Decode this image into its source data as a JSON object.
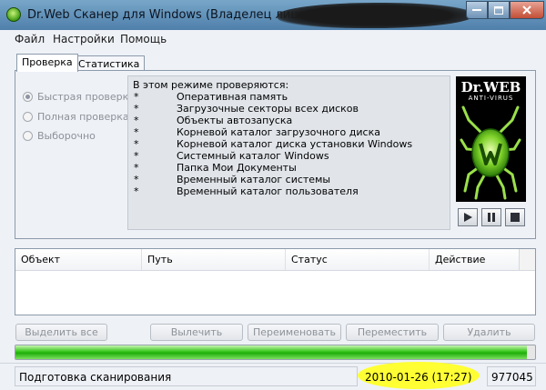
{
  "window": {
    "title": "Dr.Web Сканер для Windows (Владелец лицензии:"
  },
  "menu": [
    "Файл",
    "Настройки",
    "Помощь"
  ],
  "tabs": [
    {
      "label": "Проверка",
      "active": true
    },
    {
      "label": "Статистика",
      "active": false
    }
  ],
  "scan_modes": [
    {
      "label": "Быстрая проверка",
      "selected": true
    },
    {
      "label": "Полная проверка",
      "selected": false
    },
    {
      "label": "Выборочно",
      "selected": false
    }
  ],
  "info": {
    "heading": "В этом режиме проверяются:",
    "bullet": "*",
    "items": [
      "Оперативная память",
      "Загрузочные секторы всех дисков",
      "Объекты автозапуска",
      "Корневой каталог загрузочного диска",
      "Корневой каталог диска установки Windows",
      "Системный каталог Windows",
      "Папка Мои Документы",
      "Временный каталог системы",
      "Временный каталог пользователя"
    ]
  },
  "logo": {
    "brand": "Dr.WEB",
    "sub": "ANTI-VIRUS"
  },
  "controls": [
    "play-icon",
    "pause-icon",
    "stop-icon"
  ],
  "table": {
    "columns": [
      "Объект",
      "Путь",
      "Статус",
      "Действие"
    ]
  },
  "actions": [
    "Выделить все",
    "Вылечить",
    "Переименовать",
    "Переместить",
    "Удалить"
  ],
  "progress": {
    "fraction": 0.985
  },
  "status": {
    "text": "Подготовка сканирования",
    "date": "2010-01-26 (17:27)",
    "count": "977045"
  },
  "colors": {
    "progress": "#35c51a",
    "highlight": "#ffff28",
    "title_bar": "#5a8ab3"
  }
}
